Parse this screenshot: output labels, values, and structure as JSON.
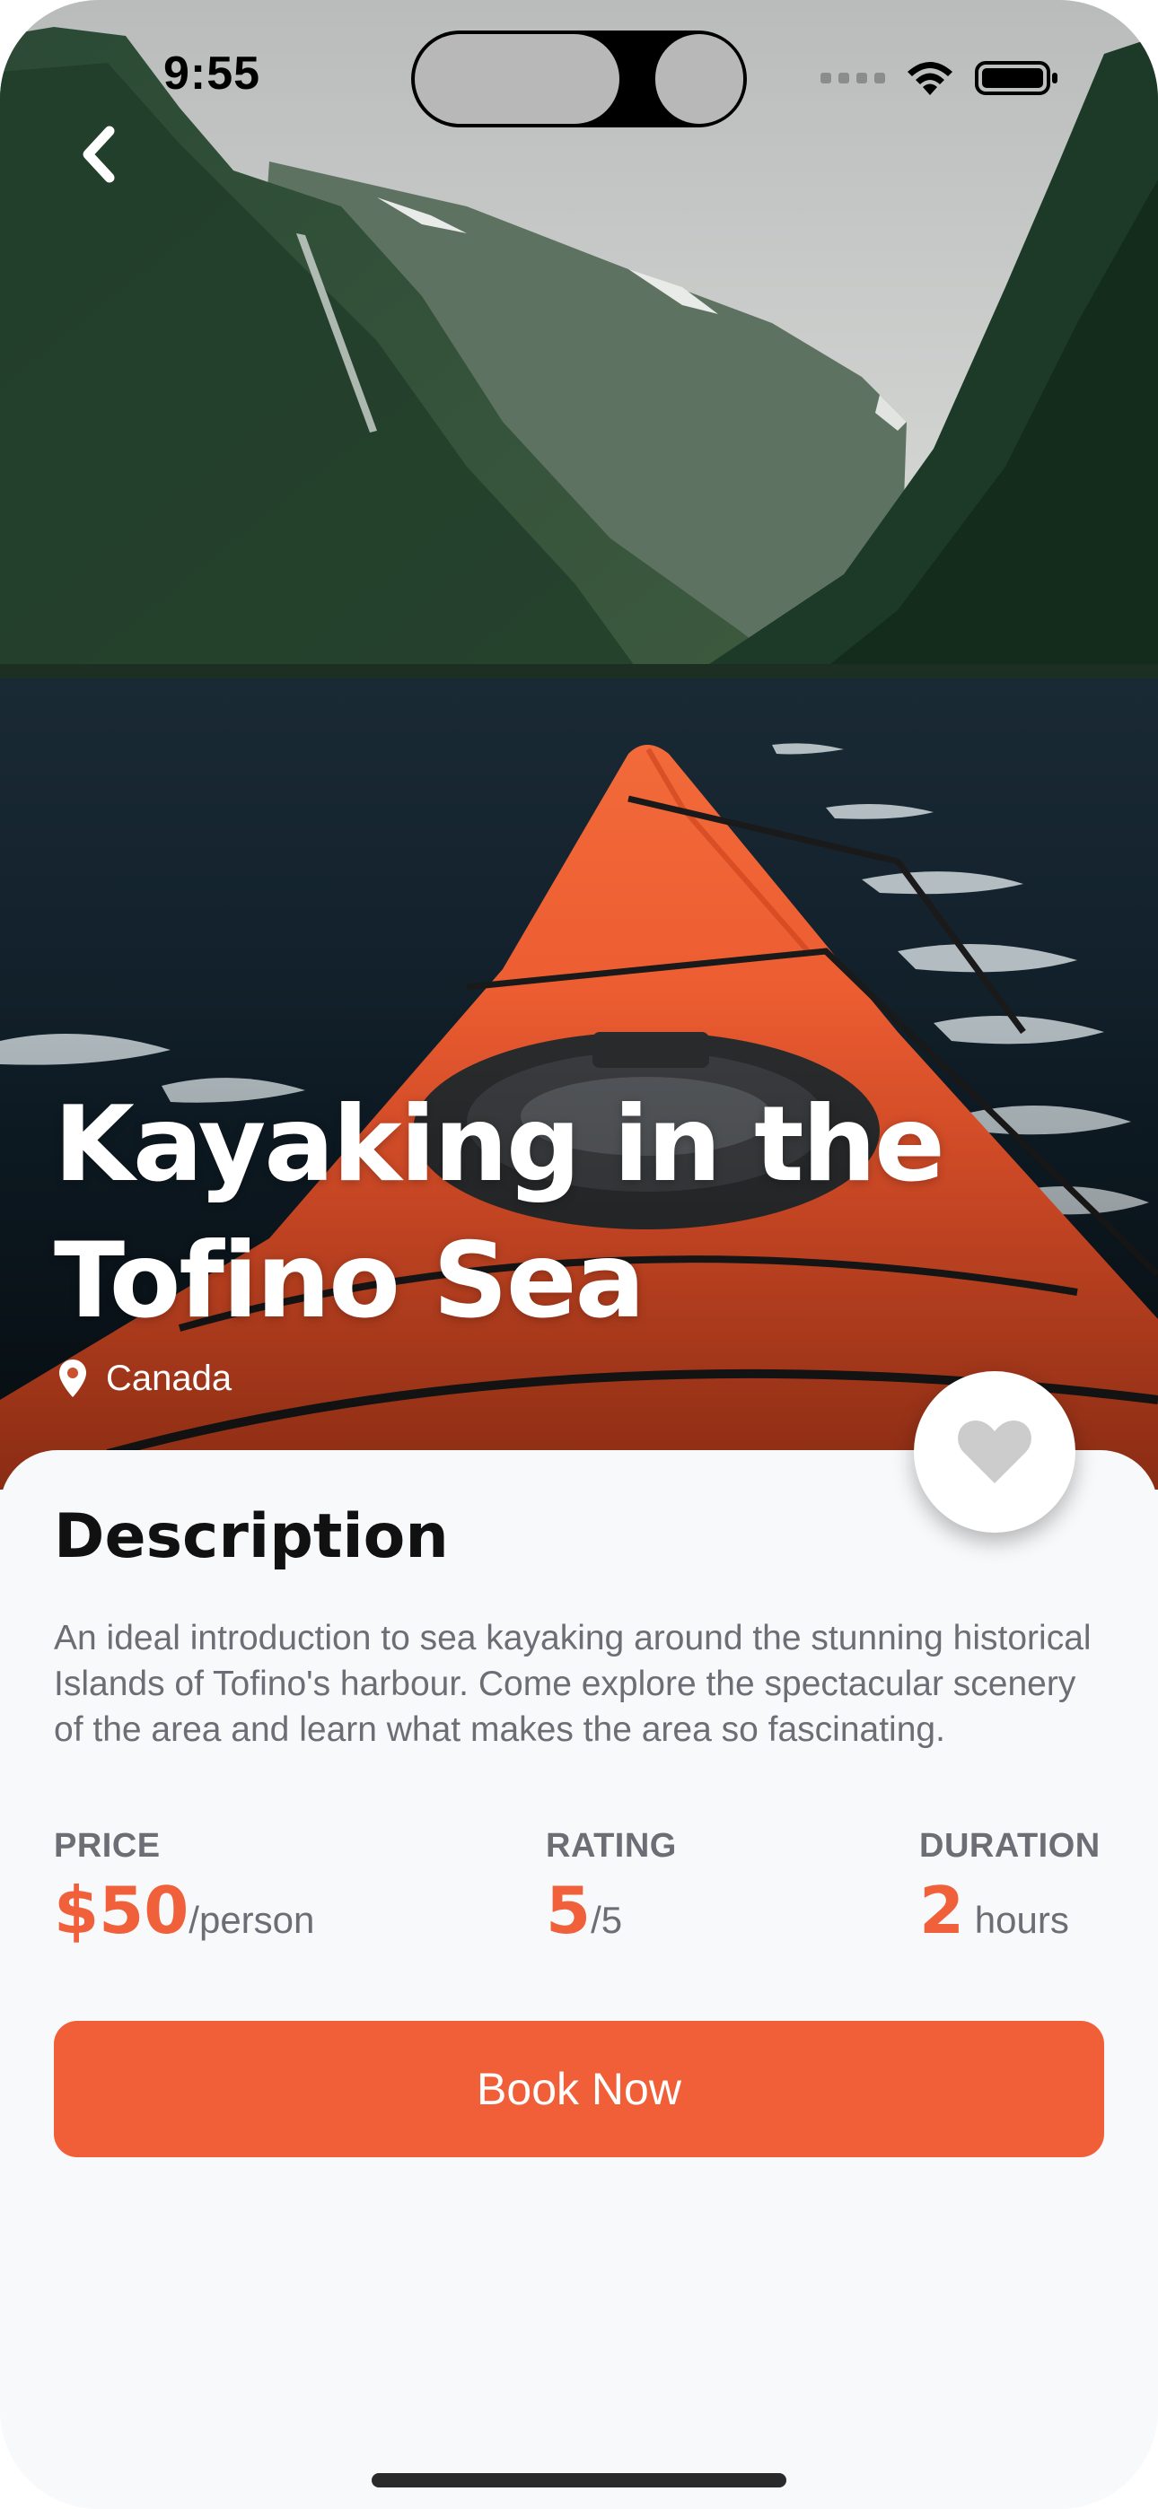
{
  "status_bar": {
    "time": "9:55"
  },
  "hero": {
    "title_line1": "Kayaking in the",
    "title_line2": "Tofino Sea",
    "location": "Canada"
  },
  "description": {
    "heading": "Description",
    "text": "An ideal introduction to sea kayaking around the stunning historical Islands of Tofino's harbour. Come explore the spectacular scenery of the area and learn what makes the area so fascinating."
  },
  "stats": {
    "price": {
      "label": "PRICE",
      "value": "$50",
      "unit": "/person"
    },
    "rating": {
      "label": "RATING",
      "value": "5",
      "unit": "/5"
    },
    "duration": {
      "label": "DURATION",
      "value": "2",
      "unit": " hours"
    }
  },
  "actions": {
    "book_label": "Book Now"
  },
  "colors": {
    "accent": "#f15f39",
    "heart": "#cccccc"
  },
  "icons": {
    "back": "chevron-left-icon",
    "location": "location-pin-icon",
    "favorite": "heart-icon",
    "wifi": "wifi-icon",
    "battery": "battery-icon"
  }
}
